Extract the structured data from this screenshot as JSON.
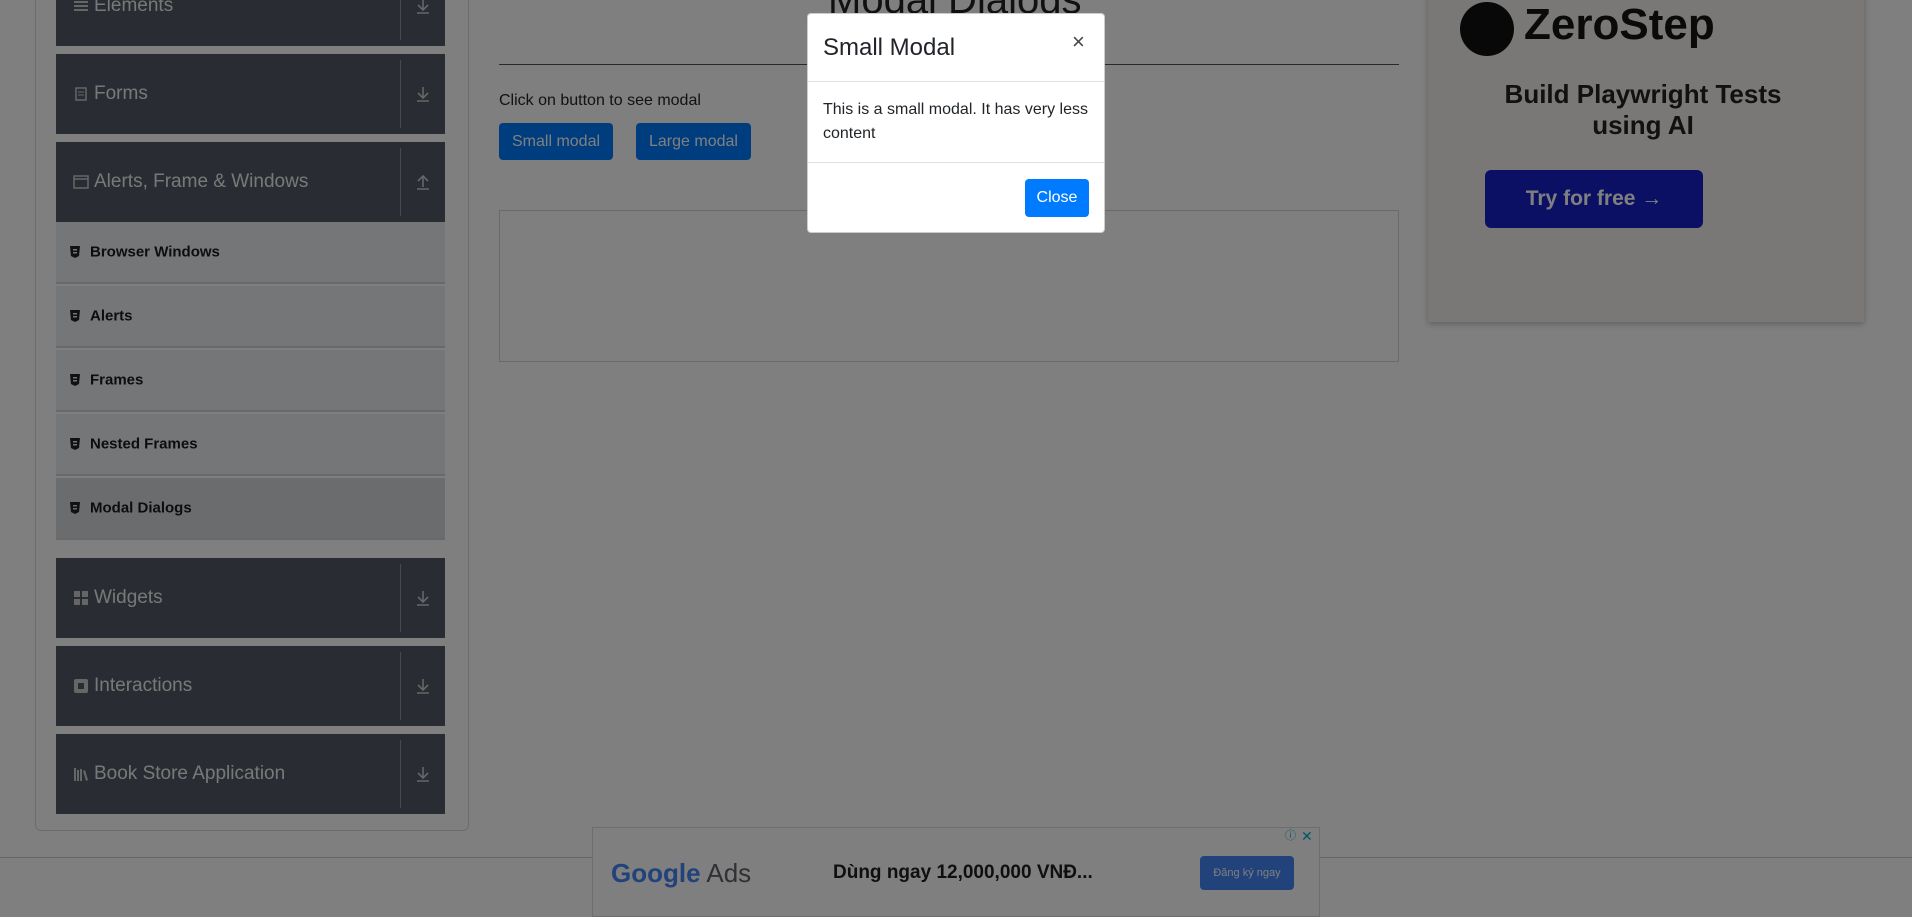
{
  "sidebar": {
    "groups": [
      {
        "label": "Elements",
        "icon": "list-icon",
        "toggle": "download-arrow-icon"
      },
      {
        "label": "Forms",
        "icon": "document-icon",
        "toggle": "download-arrow-icon"
      },
      {
        "label": "Alerts, Frame & Windows",
        "icon": "window-icon",
        "toggle": "upload-arrow-icon"
      },
      {
        "label": "Widgets",
        "icon": "grid-icon",
        "toggle": "download-arrow-icon"
      },
      {
        "label": "Interactions",
        "icon": "interactions-icon",
        "toggle": "download-arrow-icon"
      },
      {
        "label": "Book Store Application",
        "icon": "books-icon",
        "toggle": "download-arrow-icon"
      }
    ],
    "sub_items": [
      {
        "label": "Browser Windows",
        "active": false
      },
      {
        "label": "Alerts",
        "active": false
      },
      {
        "label": "Frames",
        "active": false
      },
      {
        "label": "Nested Frames",
        "active": false
      },
      {
        "label": "Modal Dialogs",
        "active": true
      }
    ]
  },
  "main": {
    "title": "Modal Dialogs",
    "instruction": "Click on button to see modal",
    "small_modal_button": "Small modal",
    "large_modal_button": "Large modal"
  },
  "ad_right": {
    "brand": "ZeroStep",
    "tagline": "Build Playwright Tests using AI",
    "cta": "Try for free →"
  },
  "ad_bottom": {
    "logo_google": "Google",
    "logo_ads": "Ads",
    "headline": "Dùng ngay 12,000,000 VNĐ...",
    "cta": "Đăng ký ngay"
  },
  "modal": {
    "title": "Small Modal",
    "close_symbol": "×",
    "body": "This is a small modal. It has very less content",
    "close_button": "Close"
  },
  "colors": {
    "primary": "#007bff",
    "sidebar_header": "#525a66",
    "sub_item_bg": "#e9ecef",
    "backdrop": "rgba(0,0,0,0.5)"
  }
}
